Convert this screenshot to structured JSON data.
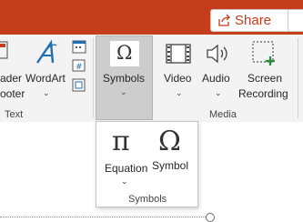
{
  "titlebar": {
    "color": "#c43e1c"
  },
  "share": {
    "label": "Share",
    "icon": "share-icon"
  },
  "ribbon": {
    "text_group": {
      "label": "Text",
      "header_footer_label_1": "ader",
      "header_footer_label_2": "ooter",
      "wordart_label": "WordArt",
      "wordart_icon": "wordart-icon",
      "datetime_icon": "date-time-icon",
      "slide_number_icon": "slide-number-icon",
      "object_icon": "object-icon"
    },
    "symbols": {
      "label": "Symbols",
      "icon": "omega-icon"
    },
    "media_group": {
      "label": "Media",
      "video_label": "Video",
      "audio_label": "Audio",
      "screen_recording_label_1": "Screen",
      "screen_recording_label_2": "Recording"
    }
  },
  "symbols_dropdown": {
    "equation_label": "Equation",
    "symbol_label": "Symbol",
    "group_label": "Symbols",
    "equation_icon": "pi-icon",
    "symbol_icon": "omega-icon"
  }
}
